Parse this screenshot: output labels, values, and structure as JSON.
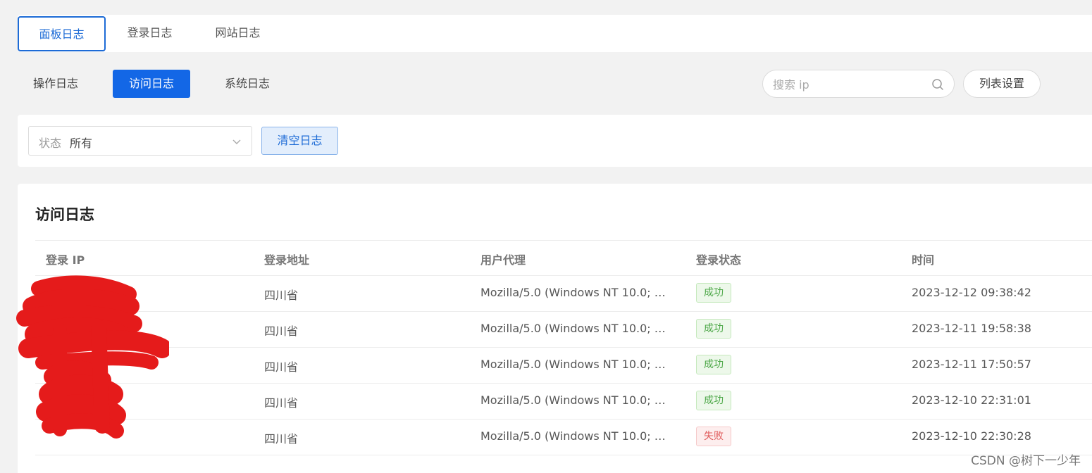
{
  "top_tabs": [
    {
      "label": "面板日志",
      "active": true
    },
    {
      "label": "登录日志",
      "active": false
    },
    {
      "label": "网站日志",
      "active": false
    }
  ],
  "sub_tabs": [
    {
      "label": "操作日志",
      "active": false
    },
    {
      "label": "访问日志",
      "active": true
    },
    {
      "label": "系统日志",
      "active": false
    }
  ],
  "search": {
    "placeholder": "搜索 ip",
    "value": ""
  },
  "column_settings_label": "列表设置",
  "filter": {
    "status_label": "状态",
    "status_value": "所有",
    "clear_label": "清空日志"
  },
  "card": {
    "title": "访问日志"
  },
  "table": {
    "headers": [
      "登录 IP",
      "登录地址",
      "用户代理",
      "登录状态",
      "时间"
    ],
    "rows": [
      {
        "ip": "",
        "location": "四川省",
        "agent": "Mozilla/5.0 (Windows NT 10.0; …",
        "status": "成功",
        "time": "2023-12-12 09:38:42"
      },
      {
        "ip": "",
        "location": "四川省",
        "agent": "Mozilla/5.0 (Windows NT 10.0; …",
        "status": "成功",
        "time": "2023-12-11 19:58:38"
      },
      {
        "ip": "",
        "location": "四川省",
        "agent": "Mozilla/5.0 (Windows NT 10.0; …",
        "status": "成功",
        "time": "2023-12-11 17:50:57"
      },
      {
        "ip": "",
        "location": "四川省",
        "agent": "Mozilla/5.0 (Windows NT 10.0; …",
        "status": "成功",
        "time": "2023-12-10 22:31:01"
      },
      {
        "ip": "",
        "location": "四川省",
        "agent": "Mozilla/5.0 (Windows NT 10.0; …",
        "status": "失败",
        "time": "2023-12-10 22:30:28"
      }
    ]
  },
  "watermark": "CSDN @树下一少年",
  "colors": {
    "primary": "#1367e6",
    "success": "#4fa94a",
    "fail": "#e05a5a",
    "redaction": "#e51b1b"
  }
}
